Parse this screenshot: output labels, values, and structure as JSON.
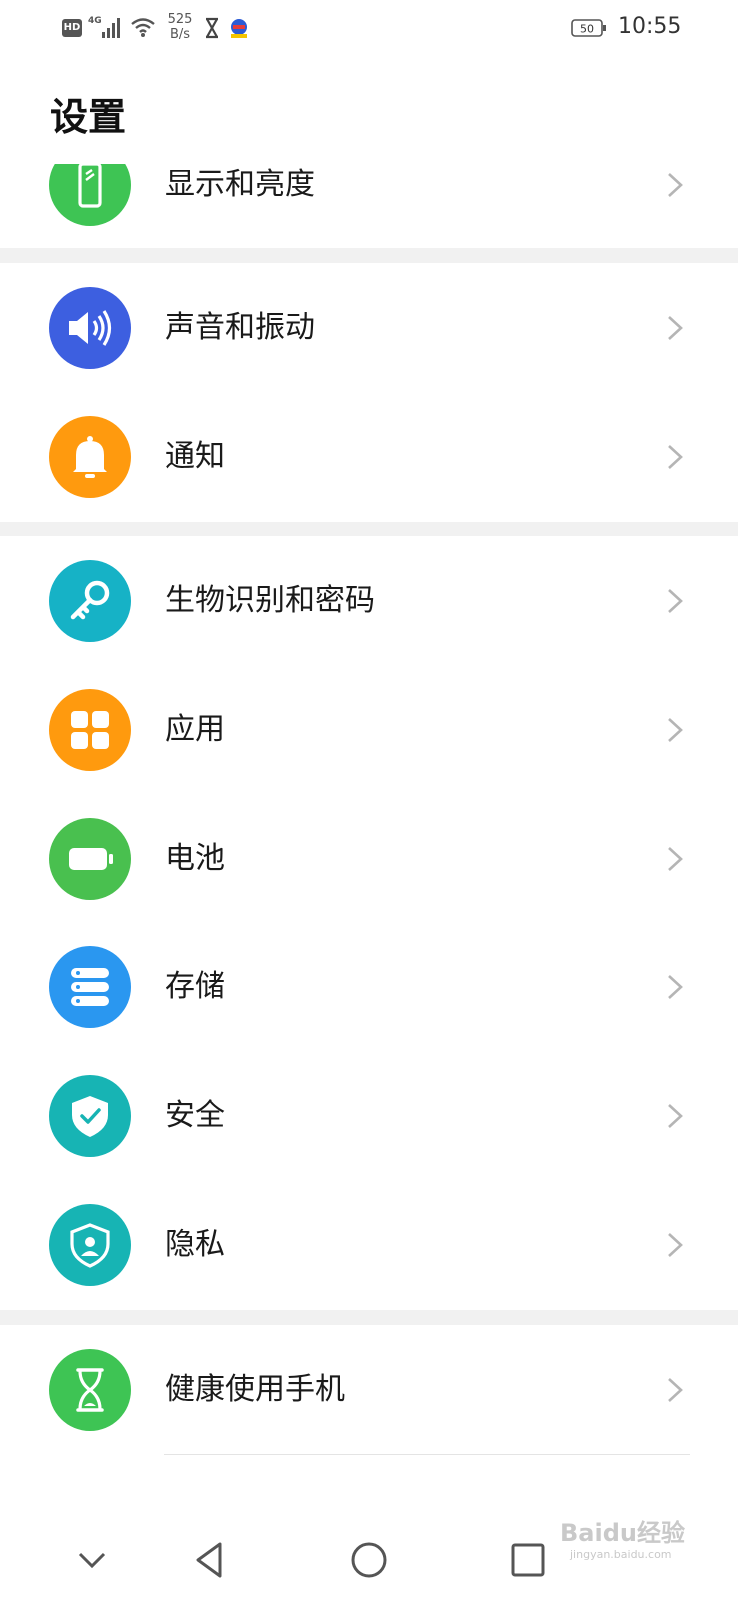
{
  "status_bar": {
    "hd": "HD",
    "network": "4G",
    "speed_value": "525",
    "speed_unit": "B/s",
    "battery": "50",
    "time": "10:55"
  },
  "page": {
    "title": "设置"
  },
  "items": [
    {
      "label": "显示和亮度",
      "icon": "display-brightness-icon",
      "color": "#3ec454"
    },
    {
      "label": "声音和振动",
      "icon": "speaker-icon",
      "color": "#3d5fe0"
    },
    {
      "label": "通知",
      "icon": "bell-icon",
      "color": "#ff9a0e"
    },
    {
      "label": "生物识别和密码",
      "icon": "key-icon",
      "color": "#16b2c6"
    },
    {
      "label": "应用",
      "icon": "apps-grid-icon",
      "color": "#ff9a0e"
    },
    {
      "label": "电池",
      "icon": "battery-icon",
      "color": "#49c04f"
    },
    {
      "label": "存储",
      "icon": "storage-icon",
      "color": "#2a97f0"
    },
    {
      "label": "安全",
      "icon": "shield-check-icon",
      "color": "#17b4b4"
    },
    {
      "label": "隐私",
      "icon": "privacy-shield-icon",
      "color": "#17b4b4"
    },
    {
      "label": "健康使用手机",
      "icon": "hourglass-icon",
      "color": "#3ec454"
    }
  ],
  "watermark": {
    "text": "Baidu经验",
    "sub": "jingyan.baidu.com"
  },
  "annotation_color": "#e8221b"
}
